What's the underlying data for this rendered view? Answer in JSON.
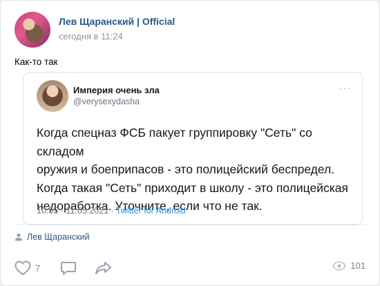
{
  "post": {
    "author": "Лев Щаранский | Official",
    "time": "сегодня в 11:24",
    "text": "Как-то так"
  },
  "tweet": {
    "user": "Империя очень зла",
    "handle": "@verysexydasha",
    "more": "···",
    "lines": [
      "Когда спецназ ФСБ пакует группировку \"Сеть\" со складом",
      "оружия и боеприпасов - это полицейский беспредел.",
      "Когда такая \"Сеть\" приходит в школу - это полицейская",
      "недоработка. Уточните, если что не так."
    ],
    "time": "10:55",
    "date": "11.05.2021",
    "client": "Twitter for Android",
    "separator": " · "
  },
  "signer": {
    "name": "Лев Щаранский",
    "icon": "person-icon"
  },
  "actions": {
    "likes": "7",
    "views": "101",
    "like_icon": "heart-icon",
    "comment_icon": "comment-icon",
    "share_icon": "share-icon",
    "views_icon": "eye-icon"
  },
  "colors": {
    "link": "#2a5885",
    "twitter_blue": "#1b95e0",
    "muted": "#939393"
  }
}
